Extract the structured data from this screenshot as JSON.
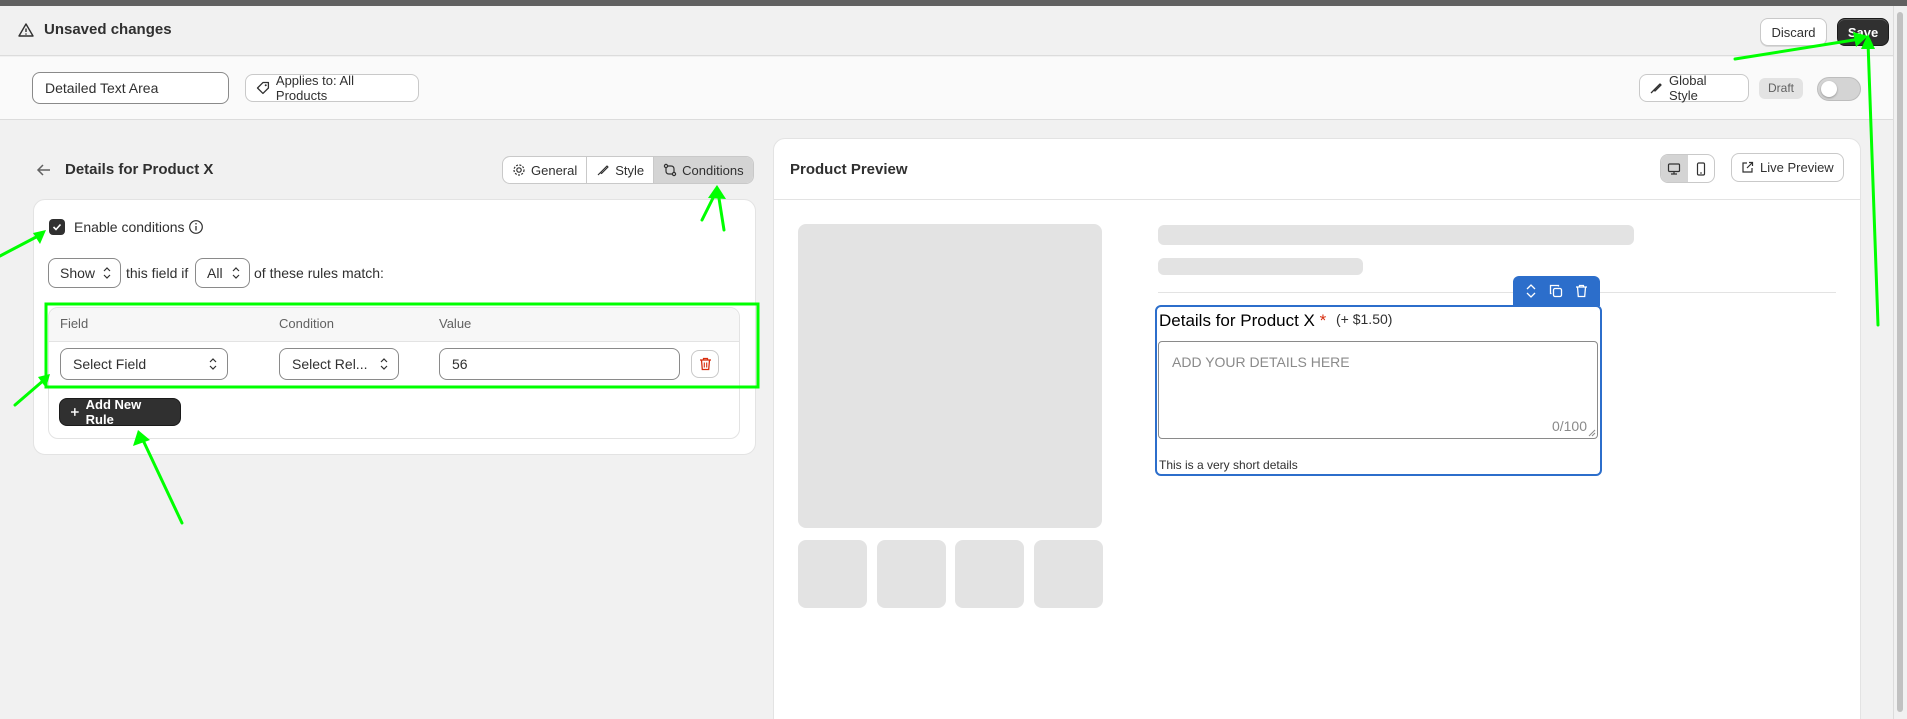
{
  "savebar": {
    "title": "Unsaved changes",
    "discard_label": "Discard",
    "save_label": "Save"
  },
  "toolbar": {
    "field_name_value": "Detailed Text Area",
    "applies_label": "Applies to: All Products",
    "global_style_label": "Global Style",
    "status_badge": "Draft",
    "publish_toggle_on": false
  },
  "editor": {
    "title": "Details for Product X",
    "tabs": [
      {
        "label": "General",
        "icon": "gear-icon",
        "active": false
      },
      {
        "label": "Style",
        "icon": "brush-icon",
        "active": false
      },
      {
        "label": "Conditions",
        "icon": "branch-icon",
        "active": true
      }
    ],
    "conditions": {
      "enabled": true,
      "enable_label": "Enable conditions",
      "action_select": "Show",
      "text_1": "this field if",
      "match_select": "All",
      "text_2": "of these rules match:",
      "columns": [
        "Field",
        "Condition",
        "Value"
      ],
      "rules": [
        {
          "field": "Select Field",
          "condition": "Select Rel...",
          "value": "56"
        }
      ],
      "add_rule_label": "Add New Rule"
    }
  },
  "preview": {
    "title": "Product Preview",
    "live_preview_label": "Live Preview",
    "device_active": "desktop",
    "field": {
      "label": "Details for Product X",
      "required_mark": "*",
      "price": "(+ $1.50)",
      "placeholder": "ADD YOUR DETAILS HERE",
      "counter": "0/100",
      "helper_text": "This is a very short details"
    }
  },
  "colors": {
    "annotation": "#00ff00",
    "selection": "#2c6ecb",
    "primary_button": "#303030",
    "danger": "#d72c0d"
  }
}
